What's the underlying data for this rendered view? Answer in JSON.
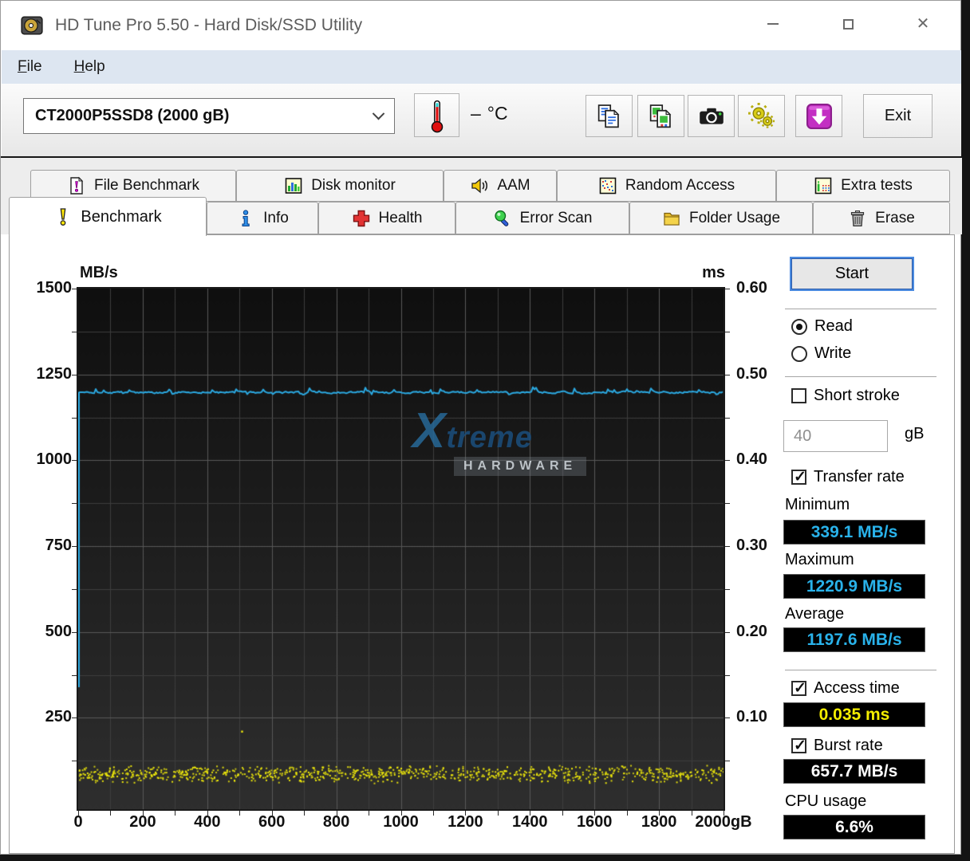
{
  "titlebar": {
    "title": "HD Tune Pro 5.50 - Hard Disk/SSD Utility"
  },
  "menu": {
    "items": [
      {
        "label": "File"
      },
      {
        "label": "Help"
      }
    ]
  },
  "toolbar": {
    "drive": "CT2000P5SSD8 (2000 gB)",
    "temp_value": "–",
    "temp_unit": "°C",
    "exit_label": "Exit"
  },
  "icons": {
    "app": "hard-disk",
    "thermometer": "temperature",
    "copy_text": "copy-report-text",
    "copy_image": "copy-screenshot-image",
    "camera": "save-screenshot",
    "gears": "yellow-gears",
    "download": "magenta-download-arrow"
  },
  "tabs": {
    "row1": [
      {
        "label": "File Benchmark"
      },
      {
        "label": "Disk monitor"
      },
      {
        "label": "AAM"
      },
      {
        "label": "Random Access"
      },
      {
        "label": "Extra tests"
      }
    ],
    "row2": [
      {
        "label": "Benchmark",
        "active": true
      },
      {
        "label": "Info"
      },
      {
        "label": "Health"
      },
      {
        "label": "Error Scan"
      },
      {
        "label": "Folder Usage"
      },
      {
        "label": "Erase"
      }
    ]
  },
  "panel": {
    "start_label": "Start",
    "read_label": "Read",
    "write_label": "Write",
    "read_selected": true,
    "short_stroke_label": "Short stroke",
    "short_stroke_checked": false,
    "capacity_value": "40",
    "capacity_unit": "gB",
    "transfer_rate_label": "Transfer rate",
    "transfer_rate_checked": true,
    "minimum_label": "Minimum",
    "minimum_value": "339.1 MB/s",
    "maximum_label": "Maximum",
    "maximum_value": "1220.9 MB/s",
    "average_label": "Average",
    "average_value": "1197.6 MB/s",
    "access_time_label": "Access time",
    "access_time_value": "0.035 ms",
    "access_time_checked": true,
    "burst_rate_label": "Burst rate",
    "burst_rate_value": "657.7 MB/s",
    "burst_rate_checked": true,
    "cpu_usage_label": "CPU usage",
    "cpu_usage_value": "6.6%"
  },
  "watermark": {
    "line1": "Xtreme",
    "line2": "HARDWARE"
  },
  "chart_data": {
    "type": "line",
    "title": "",
    "x_axis": {
      "min": 0,
      "max": 2000,
      "major_step": 200,
      "minor_step": 100,
      "tick_labels": [
        "0",
        "200",
        "400",
        "600",
        "800",
        "1000",
        "1200",
        "1400",
        "1600",
        "1800",
        "2000"
      ],
      "last_label_suffix": "gB"
    },
    "y_left": {
      "title": "MB/s",
      "min": 0,
      "max": 1500,
      "major_step": 250,
      "minor_step": 125,
      "tick_labels": [
        "1500",
        "1250",
        "1000",
        "750",
        "500",
        "250"
      ]
    },
    "y_right": {
      "title": "ms",
      "min": 0,
      "max": 0.6,
      "major_step": 0.1,
      "minor_step": 0.05,
      "tick_labels": [
        "0.60",
        "0.50",
        "0.40",
        "0.30",
        "0.20",
        "0.10"
      ]
    },
    "series": [
      {
        "name": "transfer_rate",
        "kind": "line",
        "color": "#2ba8e0",
        "unit": "MB/s",
        "min": 339.1,
        "max": 1220.9,
        "avg": 1197.6,
        "noise_seed": 1337,
        "shape": "flat line near 1197 MB/s across 0-2000 gB with small noise and occasional spikes to ~1220; vertical rise from 339.1 MB/s at x=0"
      },
      {
        "name": "access_time",
        "kind": "scatter",
        "color": "#f2ec0a",
        "unit": "ms",
        "avg": 0.035,
        "band_min": 0.024,
        "band_max": 0.046,
        "count": 950,
        "noise_seed": 77,
        "outliers": [
          {
            "x": 505,
            "y": 0.085
          }
        ]
      }
    ],
    "plot": {
      "bg_top": "#0f0f0f",
      "bg_bottom": "#2e2e2e",
      "grid_minor": "#3d3d3d",
      "grid_major": "#585858",
      "border": "#1a1a1a"
    },
    "legend": null,
    "grid": true
  }
}
